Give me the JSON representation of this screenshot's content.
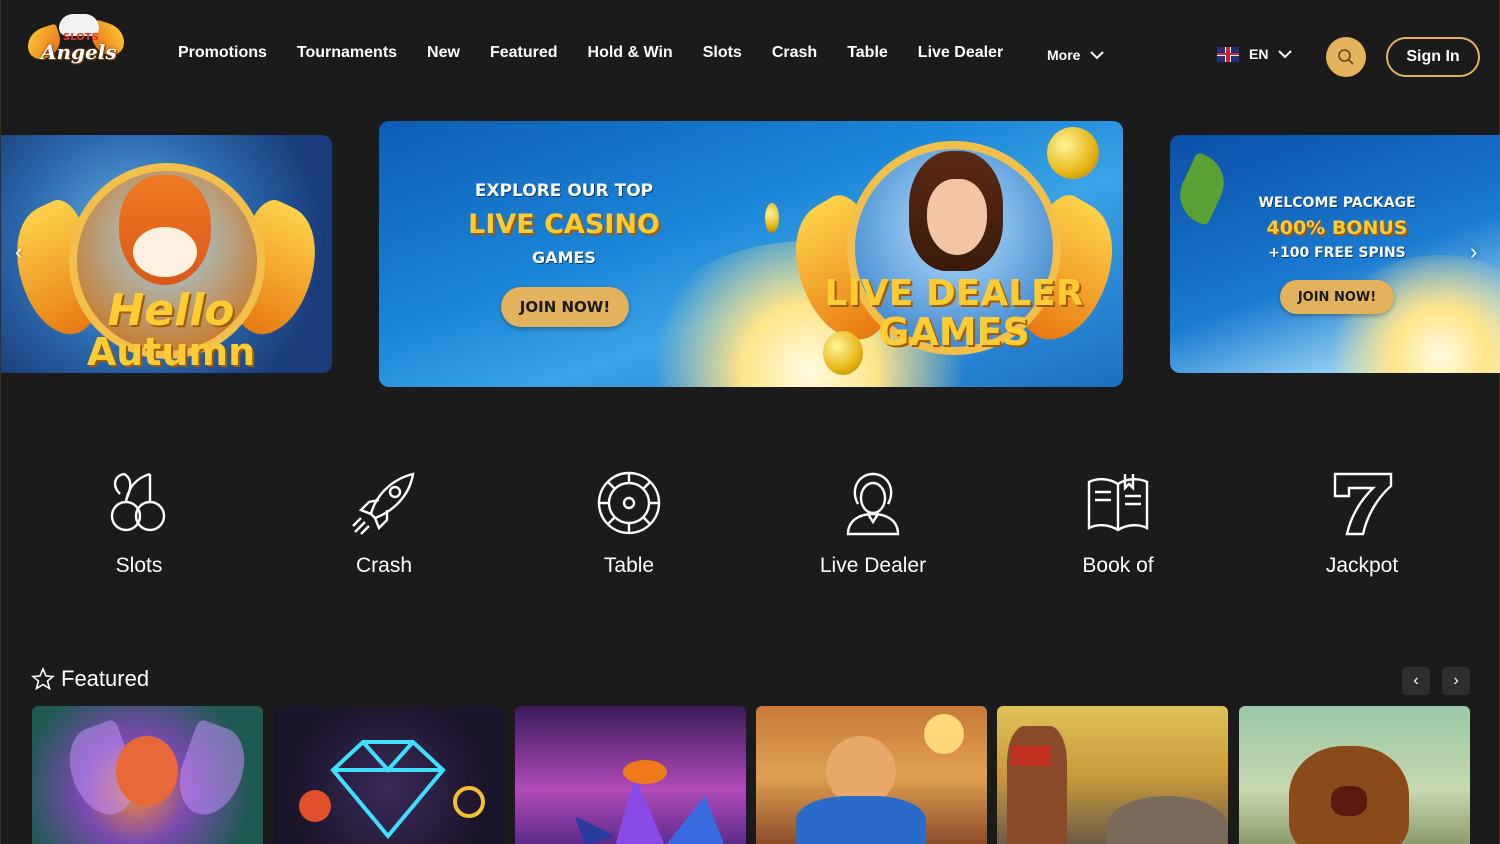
{
  "brand": {
    "logo_small": "SLOTS",
    "logo_big": "Angels"
  },
  "nav": {
    "items": [
      "Promotions",
      "Tournaments",
      "New",
      "Featured",
      "Hold & Win",
      "Slots",
      "Crash",
      "Table",
      "Live Dealer"
    ],
    "more_label": "More"
  },
  "header": {
    "language": "EN",
    "signin_label": "Sign In"
  },
  "banners": {
    "left": {
      "title_line1": "Hello",
      "title_line2": "Autumn"
    },
    "middle": {
      "line1": "EXPLORE OUR TOP",
      "line2": "LIVE CASINO",
      "line3": "GAMES",
      "cta": "JOIN NOW!",
      "art_line1": "LIVE DEALER",
      "art_line2": "GAMES"
    },
    "right": {
      "line1": "WELCOME PACKAGE",
      "line2": "400% BONUS",
      "line3": "+100 FREE SPINS",
      "cta": "JOIN NOW!"
    }
  },
  "categories": [
    {
      "label": "Slots",
      "icon": "cherries-icon"
    },
    {
      "label": "Crash",
      "icon": "rocket-icon"
    },
    {
      "label": "Table",
      "icon": "roulette-icon"
    },
    {
      "label": "Live Dealer",
      "icon": "dealer-icon"
    },
    {
      "label": "Book of",
      "icon": "book-icon"
    },
    {
      "label": "Jackpot",
      "icon": "seven-icon"
    }
  ],
  "featured": {
    "title": "Featured",
    "games": [
      {
        "theme": "fairy"
      },
      {
        "theme": "neon-diamond"
      },
      {
        "theme": "crystals"
      },
      {
        "theme": "superhero"
      },
      {
        "theme": "mountain-temple"
      },
      {
        "theme": "bear"
      }
    ]
  },
  "colors": {
    "accent": "#e3b25c",
    "background": "#1b1b1b",
    "text": "#ffffff"
  }
}
